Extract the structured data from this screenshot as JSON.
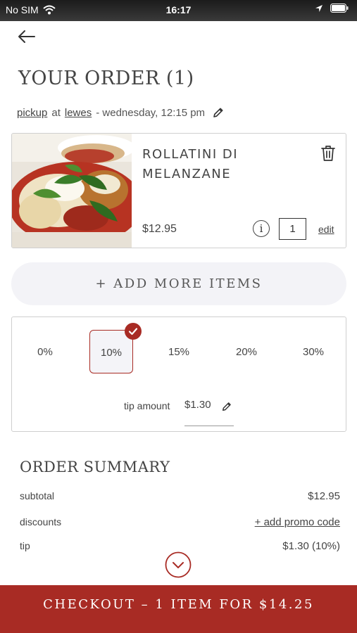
{
  "status_bar": {
    "carrier": "No SIM",
    "time": "16:17",
    "icons": [
      "wifi-icon",
      "location-arrow-icon",
      "battery-icon"
    ]
  },
  "header": {
    "title": "YOUR ORDER (1)",
    "back_icon": "back-arrow-icon"
  },
  "order_info": {
    "method": "pickup",
    "at": "at",
    "location": "lewes",
    "time": "- wednesday, 12:15 pm",
    "edit_icon": "pencil-icon"
  },
  "cart_item": {
    "name": "ROLLATINI DI MELANZANE",
    "price": "$12.95",
    "quantity": "1",
    "info_label": "i",
    "edit_label": "edit",
    "image": "food-photo"
  },
  "add_more_label": "+ ADD MORE ITEMS",
  "tips": {
    "options": [
      "0%",
      "10%",
      "15%",
      "20%",
      "30%"
    ],
    "selected": "10%",
    "amount_label": "tip amount",
    "amount_value": "$1.30"
  },
  "summary": {
    "title": "ORDER SUMMARY",
    "rows": [
      {
        "label": "subtotal",
        "value": "$12.95"
      },
      {
        "label": "discounts",
        "value": "+ add promo code"
      },
      {
        "label": "tip",
        "value": "$1.30 (10%)"
      }
    ]
  },
  "checkout_label": "CHECKOUT – 1 ITEM FOR $14.25",
  "colors": {
    "accent": "#a82b24",
    "button_bg": "#f3f3f7",
    "border": "#cfcfcf",
    "text": "#444444"
  }
}
